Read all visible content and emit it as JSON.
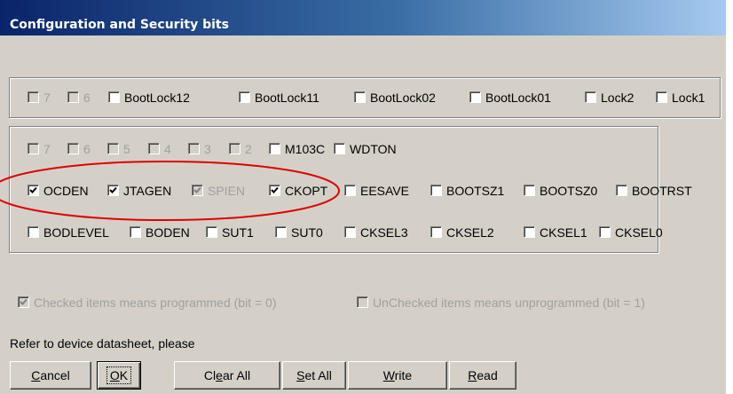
{
  "window": {
    "title": "Configuration and Security bits"
  },
  "lock_bits": [
    {
      "label": "7",
      "checked": false,
      "disabled": true
    },
    {
      "label": "6",
      "checked": false,
      "disabled": true
    },
    {
      "label": "BootLock12",
      "checked": false,
      "disabled": false
    },
    {
      "label": "BootLock11",
      "checked": false,
      "disabled": false
    },
    {
      "label": "BootLock02",
      "checked": false,
      "disabled": false
    },
    {
      "label": "BootLock01",
      "checked": false,
      "disabled": false
    },
    {
      "label": "Lock2",
      "checked": false,
      "disabled": false
    },
    {
      "label": "Lock1",
      "checked": false,
      "disabled": false
    }
  ],
  "fuse_row1": [
    {
      "label": "7",
      "checked": false,
      "disabled": true
    },
    {
      "label": "6",
      "checked": false,
      "disabled": true
    },
    {
      "label": "5",
      "checked": false,
      "disabled": true
    },
    {
      "label": "4",
      "checked": false,
      "disabled": true
    },
    {
      "label": "3",
      "checked": false,
      "disabled": true
    },
    {
      "label": "2",
      "checked": false,
      "disabled": true
    },
    {
      "label": "M103C",
      "checked": false,
      "disabled": false
    },
    {
      "label": "WDTON",
      "checked": false,
      "disabled": false
    }
  ],
  "fuse_row2": [
    {
      "label": "OCDEN",
      "checked": true,
      "disabled": false
    },
    {
      "label": "JTAGEN",
      "checked": true,
      "disabled": false
    },
    {
      "label": "SPIEN",
      "checked": true,
      "disabled": true
    },
    {
      "label": "CKOPT",
      "checked": true,
      "disabled": false
    },
    {
      "label": "EESAVE",
      "checked": false,
      "disabled": false
    },
    {
      "label": "BOOTSZ1",
      "checked": false,
      "disabled": false
    },
    {
      "label": "BOOTSZ0",
      "checked": false,
      "disabled": false
    },
    {
      "label": "BOOTRST",
      "checked": false,
      "disabled": false
    }
  ],
  "fuse_row3": [
    {
      "label": "BODLEVEL",
      "checked": false,
      "disabled": false
    },
    {
      "label": "BODEN",
      "checked": false,
      "disabled": false
    },
    {
      "label": "SUT1",
      "checked": false,
      "disabled": false
    },
    {
      "label": "SUT0",
      "checked": false,
      "disabled": false
    },
    {
      "label": "CKSEL3",
      "checked": false,
      "disabled": false
    },
    {
      "label": "CKSEL2",
      "checked": false,
      "disabled": false
    },
    {
      "label": "CKSEL1",
      "checked": false,
      "disabled": false
    },
    {
      "label": "CKSEL0",
      "checked": false,
      "disabled": false
    }
  ],
  "legend": {
    "checked_note": "Checked items means programmed (bit = 0)",
    "checked_note_checked": true,
    "unchecked_note": "UnChecked items means unprogrammed (bit = 1)",
    "unchecked_note_checked": false
  },
  "refer_text": "Refer to device datasheet, please",
  "buttons": {
    "cancel": {
      "pre": "",
      "key": "C",
      "post": "ancel"
    },
    "ok": {
      "pre": "",
      "key": "O",
      "post": "K"
    },
    "clear_all": {
      "pre": "Cl",
      "key": "e",
      "post": "ar All"
    },
    "set_all": {
      "pre": "",
      "key": "S",
      "post": "et All"
    },
    "write": {
      "pre": "",
      "key": "W",
      "post": "rite"
    },
    "read": {
      "pre": "",
      "key": "R",
      "post": "ead"
    }
  },
  "highlight": {
    "color": "#e00000"
  }
}
